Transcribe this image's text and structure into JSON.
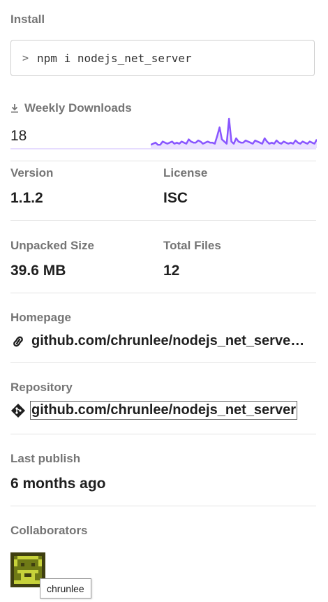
{
  "install": {
    "label": "Install",
    "prompt_symbol": ">",
    "command": "npm i nodejs_net_server"
  },
  "downloads": {
    "label": "Weekly Downloads",
    "icon": "download-icon",
    "count": "18",
    "sparkline": [
      3,
      4,
      5,
      3,
      3,
      6,
      5,
      4,
      5,
      6,
      4,
      5,
      4,
      6,
      5,
      4,
      8,
      6,
      5,
      5,
      7,
      6,
      4,
      5,
      6,
      5,
      5,
      4,
      11,
      19,
      8,
      6,
      4,
      27,
      6,
      4,
      9,
      6,
      5,
      5,
      7,
      6,
      5,
      4,
      7,
      6,
      5,
      4,
      9,
      6,
      4,
      5,
      4,
      7,
      5,
      4,
      6,
      5,
      4,
      5,
      4,
      7,
      5,
      4,
      6,
      5,
      4,
      6,
      5,
      4,
      8
    ],
    "color": "#8956ff"
  },
  "version": {
    "label": "Version",
    "value": "1.1.2"
  },
  "license": {
    "label": "License",
    "value": "ISC"
  },
  "unpacked_size": {
    "label": "Unpacked Size",
    "value": "39.6 MB"
  },
  "total_files": {
    "label": "Total Files",
    "value": "12"
  },
  "homepage": {
    "label": "Homepage",
    "url": "github.com/chrunlee/nodejs_net_serve…",
    "icon": "link-icon"
  },
  "repository": {
    "label": "Repository",
    "url": "github.com/chrunlee/nodejs_net_server",
    "icon": "git-icon"
  },
  "last_publish": {
    "label": "Last publish",
    "value": "6 months ago"
  },
  "collaborators": {
    "label": "Collaborators",
    "items": [
      {
        "name": "chrunlee",
        "tooltip": "chrunlee"
      }
    ]
  }
}
